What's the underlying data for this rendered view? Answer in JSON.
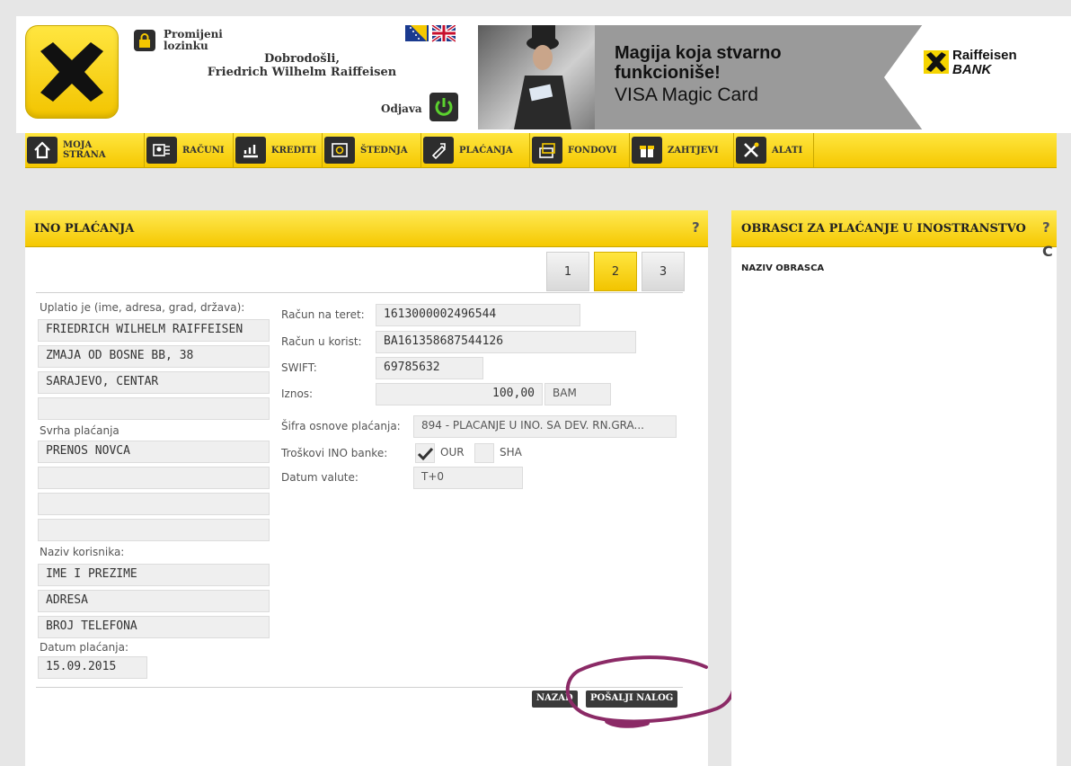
{
  "header": {
    "change_password": "Promijeni lozinku",
    "welcome_line1": "Dobrodošli,",
    "welcome_line2": "Friedrich Wilhelm Raiffeisen",
    "logout": "Odjava",
    "banner_title_line1": "Magija koja stvarno",
    "banner_title_line2": "funkcioniše!",
    "banner_subtitle": "VISA Magic Card",
    "brand_line1": "Raiffeisen",
    "brand_line2": "BANK"
  },
  "nav": [
    {
      "label": "MOJA STRANA",
      "icon": "home-icon"
    },
    {
      "label": "RAČUNI",
      "icon": "accounts-icon"
    },
    {
      "label": "KREDITI",
      "icon": "credits-icon"
    },
    {
      "label": "ŠTEDNJA",
      "icon": "savings-icon"
    },
    {
      "label": "PLAĆANJA",
      "icon": "payments-icon"
    },
    {
      "label": "FONDOVI",
      "icon": "funds-icon"
    },
    {
      "label": "ZAHTJEVI",
      "icon": "requests-icon"
    },
    {
      "label": "ALATI",
      "icon": "tools-icon"
    }
  ],
  "ino_panel": {
    "title": "INO PLAĆANJA",
    "help": "?",
    "steps": [
      "1",
      "2",
      "3"
    ],
    "active_step": "2",
    "payer_label": "Uplatio je (ime, adresa, grad, država):",
    "payer": [
      "FRIEDRICH WILHELM RAIFFEISEN",
      "ZMAJA OD BOSNE BB, 38",
      "SARAJEVO, CENTAR",
      ""
    ],
    "purpose_label": "Svrha plaćanja",
    "purpose": [
      "PRENOS NOVCA",
      "",
      "",
      ""
    ],
    "beneficiary_label": "Naziv korisnika:",
    "beneficiary": [
      "IME I PREZIME",
      "ADRESA",
      "BROJ TELEFONA"
    ],
    "date_label": "Datum plaćanja:",
    "date": "15.09.2015",
    "debit_account_label": "Račun na teret:",
    "debit_account": "1613000002496544",
    "credit_account_label": "Račun u korist:",
    "credit_account": "BA161358687544126",
    "swift_label": "SWIFT:",
    "swift": "69785632",
    "amount_label": "Iznos:",
    "amount": "100,00",
    "currency": "BAM",
    "basis_label": "Šifra osnove plaćanja:",
    "basis": "894 - PLACANJE U INO. SA DEV. RN.GRA...",
    "fees_label": "Troškovi INO banke:",
    "fee_our": "OUR",
    "fee_sha": "SHA",
    "fee_selected": "OUR",
    "value_date_label": "Datum valute:",
    "value_date": "T+0",
    "back_button": "NAZAD",
    "send_button": "POŠALJI NALOG"
  },
  "forms_panel": {
    "title": "OBRASCI ZA PLAĆANJE U INOSTRANSTVO",
    "help": "?",
    "column_header": "NAZIV OBRASCA"
  },
  "colors": {
    "accent_yellow": "#f5c800",
    "dark": "#2d2d2d",
    "annotation": "#8b2a66"
  }
}
